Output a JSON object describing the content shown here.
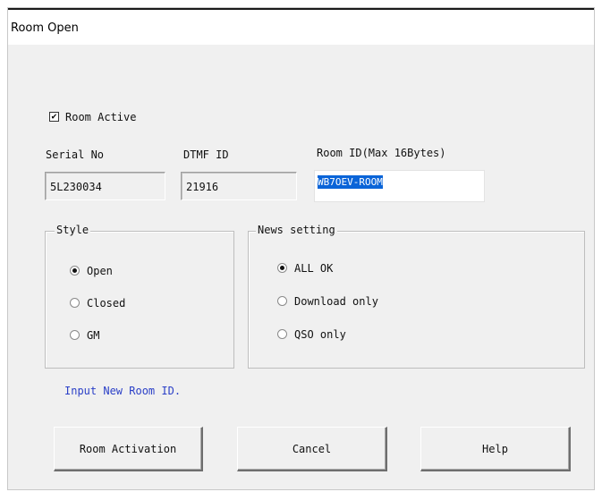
{
  "window": {
    "title": "Room Open"
  },
  "room_active": {
    "label": "Room Active",
    "checked": true
  },
  "serial_no": {
    "label": "Serial No",
    "value": "5L230034"
  },
  "dtmf_id": {
    "label": "DTMF ID",
    "value": "21916"
  },
  "room_id": {
    "label": "Room ID(Max 16Bytes)",
    "value": "WB7OEV-ROOM"
  },
  "style_group": {
    "title": "Style",
    "options": [
      {
        "label": "Open",
        "selected": true
      },
      {
        "label": "Closed",
        "selected": false
      },
      {
        "label": "GM",
        "selected": false
      }
    ]
  },
  "news_group": {
    "title": "News setting",
    "options": [
      {
        "label": "ALL OK",
        "selected": true
      },
      {
        "label": "Download only",
        "selected": false
      },
      {
        "label": "QSO only",
        "selected": false
      }
    ]
  },
  "status_text": "Input New Room ID.",
  "buttons": {
    "activate": "Room Activation",
    "cancel": "Cancel",
    "help": "Help"
  }
}
